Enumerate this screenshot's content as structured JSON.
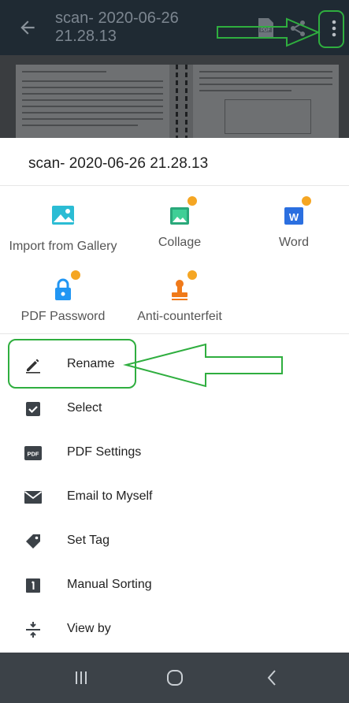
{
  "app_bar": {
    "title": "scan- 2020-06-26 21.28.13",
    "back_icon": "arrow-left-icon",
    "pdf_icon": "pdf-icon",
    "share_icon": "share-icon",
    "more_icon": "more-vertical-icon"
  },
  "sheet": {
    "title": "scan- 2020-06-26 21.28.13",
    "tools": [
      {
        "label": "Import from Gallery",
        "icon": "gallery-image-icon",
        "premium": false
      },
      {
        "label": "Collage",
        "icon": "collage-icon",
        "premium": true
      },
      {
        "label": "Word",
        "icon": "word-icon",
        "premium": true
      },
      {
        "label": "PDF Password",
        "icon": "lock-icon",
        "premium": true
      },
      {
        "label": "Anti-counterfeit",
        "icon": "stamp-icon",
        "premium": true
      }
    ],
    "menu": [
      {
        "label": "Rename",
        "icon": "pencil-icon"
      },
      {
        "label": "Select",
        "icon": "checkbox-icon"
      },
      {
        "label": "PDF Settings",
        "icon": "pdf-badge-icon"
      },
      {
        "label": "Email to Myself",
        "icon": "envelope-icon"
      },
      {
        "label": "Set Tag",
        "icon": "tag-icon"
      },
      {
        "label": "Manual Sorting",
        "icon": "sort-number-icon"
      },
      {
        "label": "View by",
        "icon": "view-by-icon"
      }
    ]
  },
  "navbar": {
    "recent_icon": "recent-apps-icon",
    "home_icon": "home-icon",
    "back_icon": "back-chevron-icon"
  },
  "colors": {
    "accent": "#26a69a",
    "premium": "#f5a623",
    "annotation": "#2fae3f",
    "app_bar_bg": "#1f2a33",
    "nav_bar_bg": "#3c4248"
  }
}
